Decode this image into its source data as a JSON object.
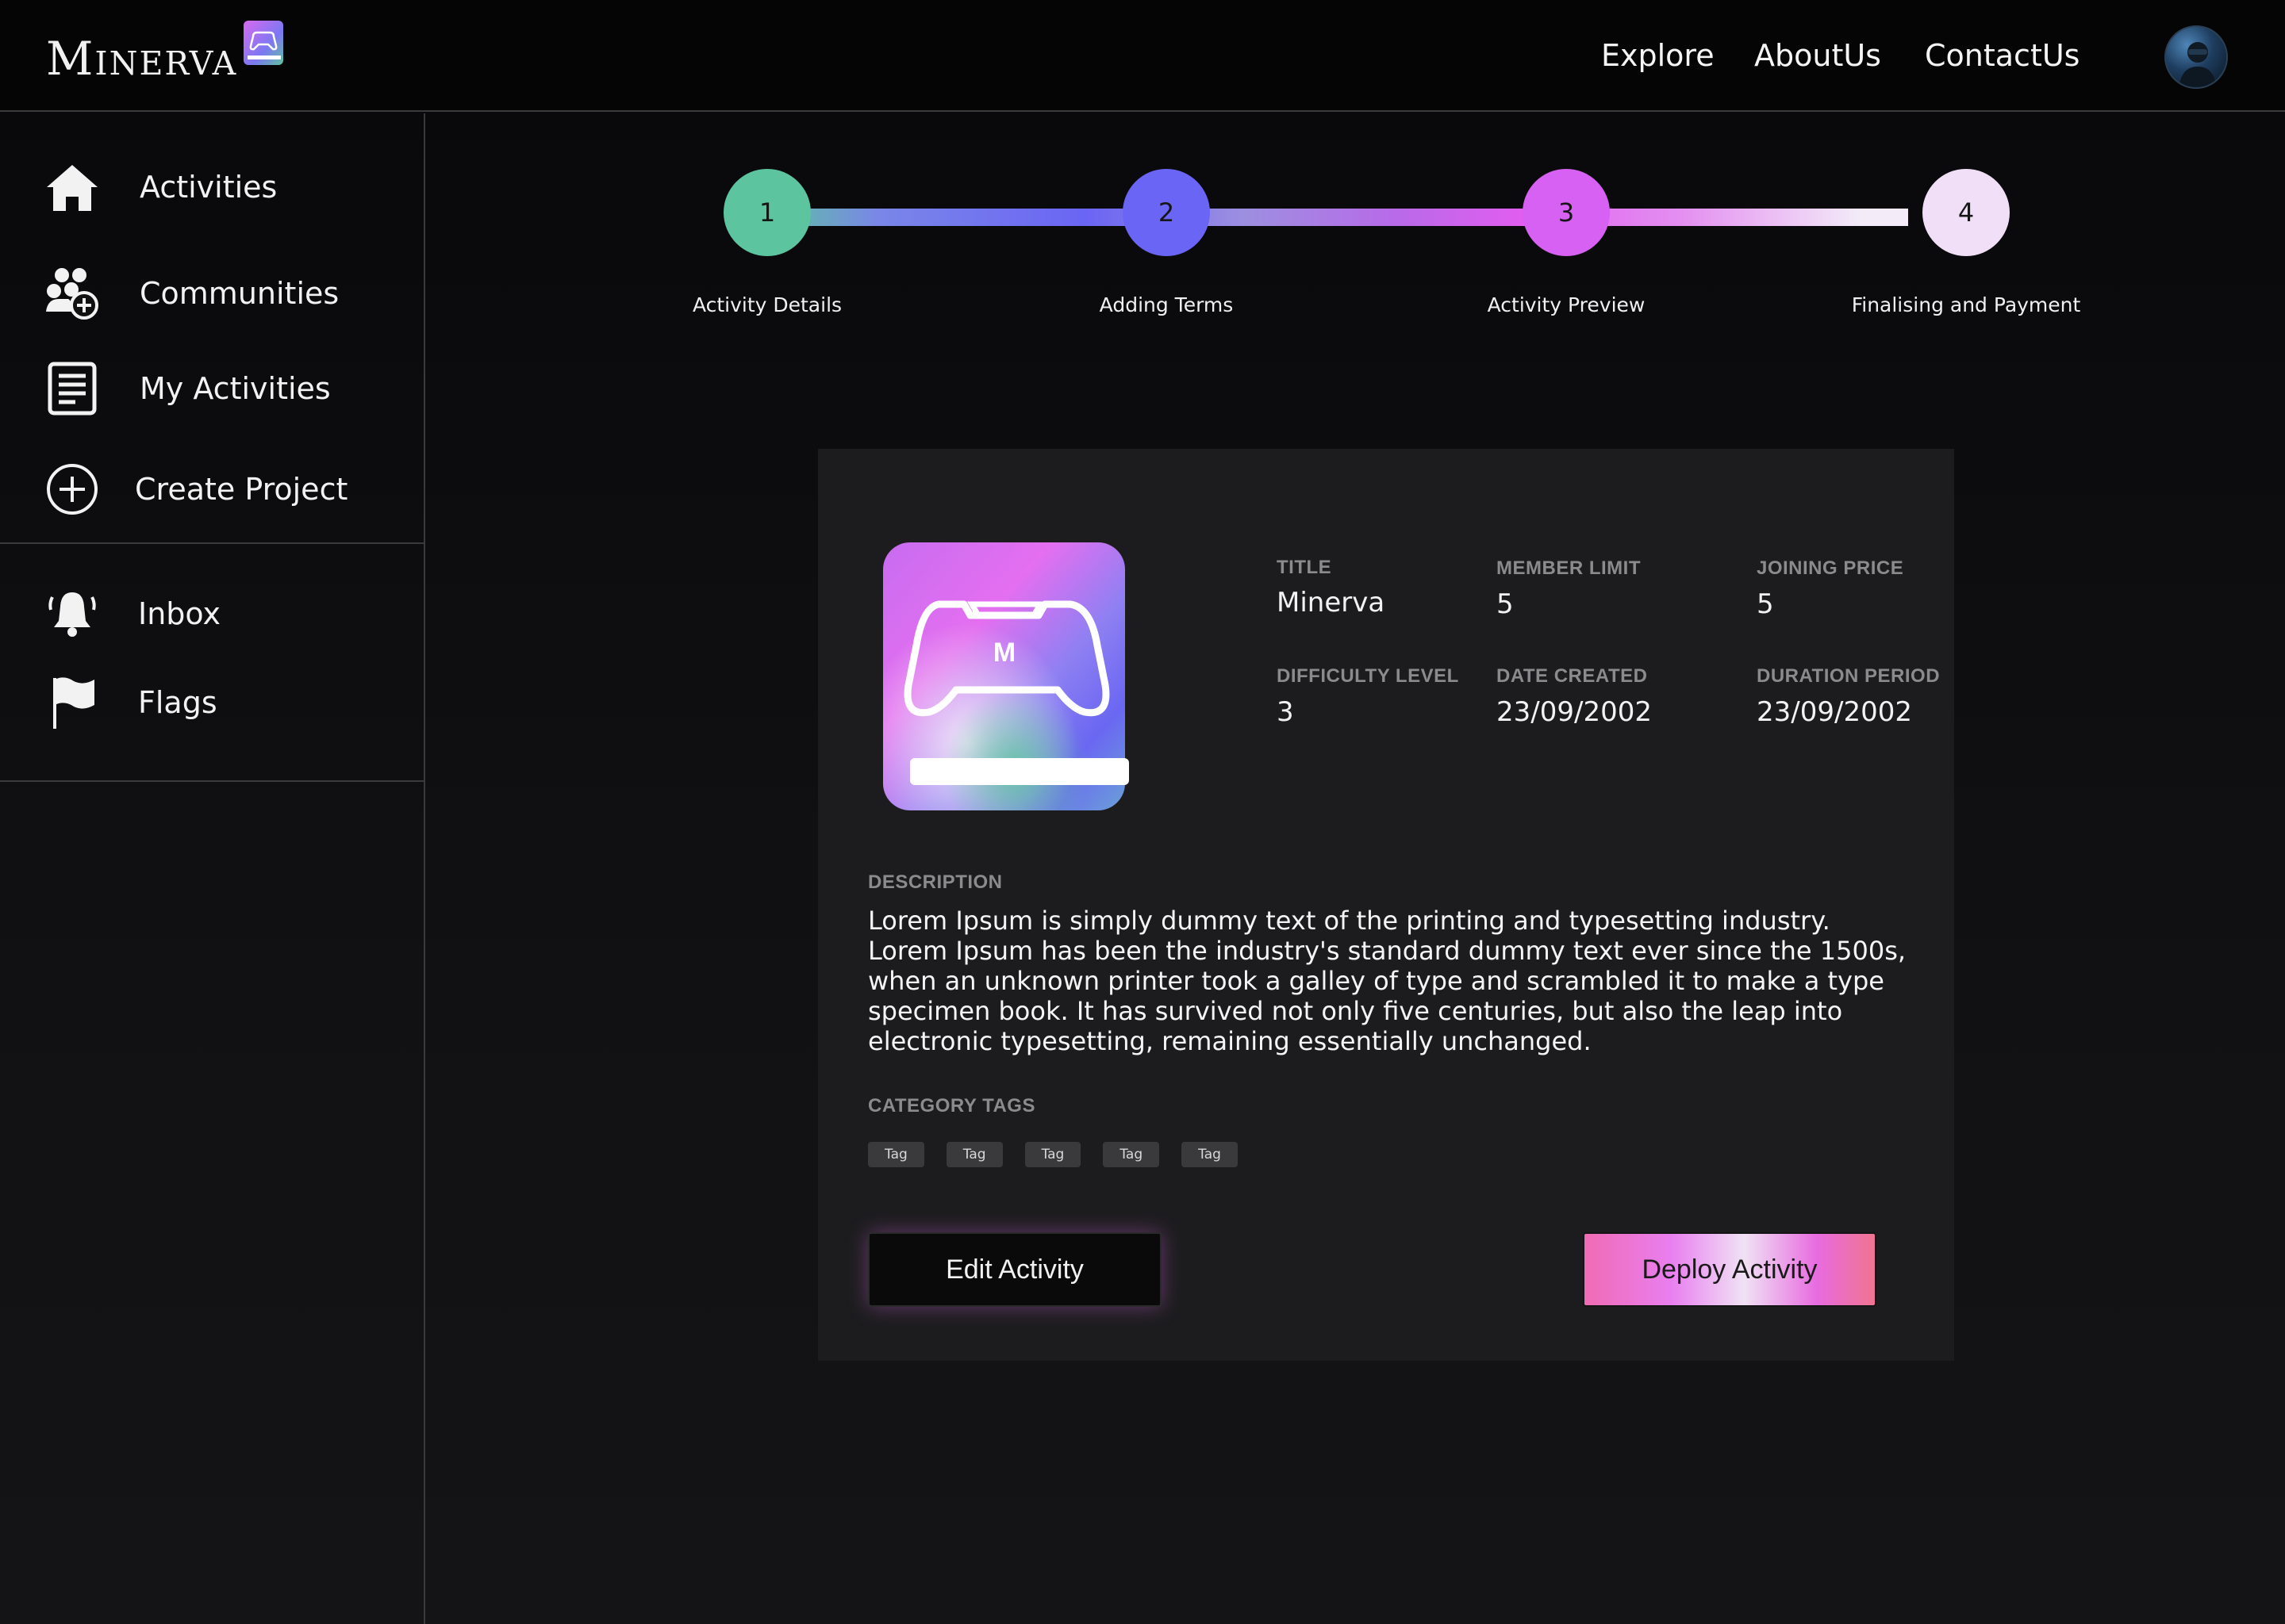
{
  "brand": {
    "name": "Minerva"
  },
  "nav": {
    "explore": "Explore",
    "about": "AboutUs",
    "contact": "ContactUs"
  },
  "sidebar": {
    "items": [
      {
        "label": "Activities",
        "icon": "home-icon"
      },
      {
        "label": "Communities",
        "icon": "community-add-icon"
      },
      {
        "label": "My Activities",
        "icon": "document-list-icon"
      },
      {
        "label": "Create Project",
        "icon": "plus-circle-icon"
      },
      {
        "label": "Inbox",
        "icon": "bell-icon"
      },
      {
        "label": "Flags",
        "icon": "flag-icon"
      }
    ]
  },
  "stepper": {
    "steps": [
      {
        "number": "1",
        "label": "Activity Details",
        "color": "#5cc49f"
      },
      {
        "number": "2",
        "label": "Adding Terms",
        "color": "#6a65f4"
      },
      {
        "number": "3",
        "label": "Activity Preview",
        "color": "#d661f2"
      },
      {
        "number": "4",
        "label": "Finalising and Payment",
        "color": "#f1dff8"
      }
    ]
  },
  "activity": {
    "logo_letter": "M",
    "fields": {
      "title": {
        "label": "TITLE",
        "value": "Minerva"
      },
      "member_limit": {
        "label": "MEMBER LIMIT",
        "value": "5"
      },
      "joining_price": {
        "label": "JOINING PRICE",
        "value": "5"
      },
      "difficulty_level": {
        "label": "DIFFICULTY LEVEL",
        "value": "3"
      },
      "date_created": {
        "label": "DATE CREATED",
        "value": "23/09/2002"
      },
      "duration_period": {
        "label": "DURATION PERIOD",
        "value": "23/09/2002"
      }
    },
    "description": {
      "label": "DESCRIPTION",
      "text": "Lorem Ipsum is simply dummy text of the printing and typesetting industry. Lorem Ipsum has been the industry's standard dummy text ever since the 1500s, when an unknown printer took a galley of type and scrambled it to make a type specimen book. It has survived not only five centuries, but also the leap into electronic typesetting, remaining essentially unchanged."
    },
    "tags": {
      "label": "CATEGORY TAGS",
      "items": [
        "Tag",
        "Tag",
        "Tag",
        "Tag",
        "Tag"
      ]
    }
  },
  "actions": {
    "edit_label": "Edit Activity",
    "deploy_label": "Deploy Activity"
  },
  "colors": {
    "accent_green": "#5cc49f",
    "accent_blue": "#6a65f4",
    "accent_purple": "#d661f2",
    "accent_pink": "#f06bb4"
  }
}
